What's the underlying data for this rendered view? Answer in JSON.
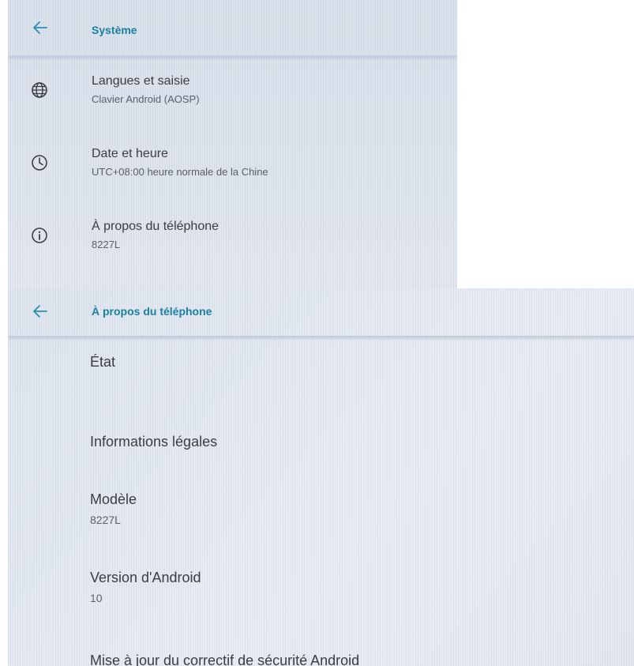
{
  "top_screen": {
    "title": "Système",
    "items": [
      {
        "title": "Langues et saisie",
        "subtitle": "Clavier Android (AOSP)",
        "icon": "globe-icon"
      },
      {
        "title": "Date et heure",
        "subtitle": "UTC+08:00 heure normale de la Chine",
        "icon": "clock-icon"
      },
      {
        "title": "À propos du téléphone",
        "subtitle": "8227L",
        "icon": "info-icon"
      }
    ]
  },
  "bottom_screen": {
    "title": "À propos du téléphone",
    "items": [
      {
        "title": "État"
      },
      {
        "title": "Informations légales"
      },
      {
        "title": "Modèle",
        "subtitle": "8227L"
      },
      {
        "title": "Version d'Android",
        "subtitle": "10"
      },
      {
        "title": "Mise à jour du correctif de sécurité Android"
      }
    ]
  },
  "colors": {
    "accent": "#1a7fa0",
    "text_primary": "#3a3d44",
    "text_secondary": "#5a5f69",
    "background": "#dfe6f0"
  }
}
